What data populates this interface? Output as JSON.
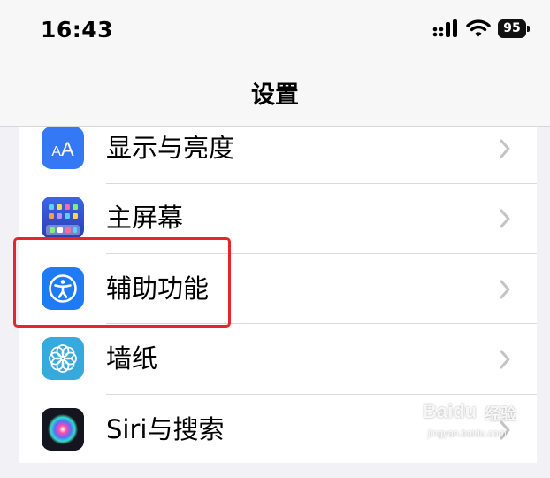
{
  "status_bar": {
    "time": "16:43",
    "battery_level": "95",
    "icons": [
      "cellular-signal-icon",
      "wifi-icon",
      "battery-icon"
    ]
  },
  "navbar": {
    "title": "设置"
  },
  "settings_rows": [
    {
      "label": "显示与亮度",
      "icon": "display-brightness-icon",
      "color": "#3478f6"
    },
    {
      "label": "主屏幕",
      "icon": "home-screen-icon",
      "color": "#2d5bd6"
    },
    {
      "label": "辅助功能",
      "icon": "accessibility-icon",
      "color": "#1f7bf5"
    },
    {
      "label": "墙纸",
      "icon": "wallpaper-icon",
      "color": "#36aadc"
    },
    {
      "label": "Siri与搜索",
      "icon": "siri-icon",
      "color": "#1a1a2a"
    }
  ],
  "annotation": {
    "highlighted_row": "辅助功能",
    "color": "#e8262a"
  },
  "watermark": {
    "brand": "Baidu",
    "brand_cn": "经验",
    "url": "jingyan.baidu.com"
  }
}
